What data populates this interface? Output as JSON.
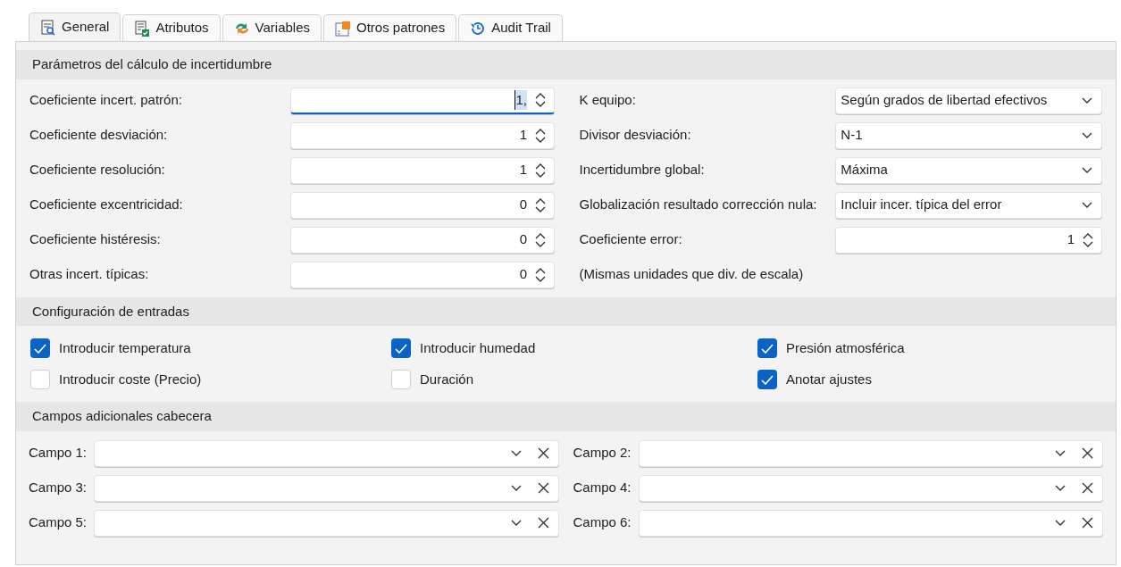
{
  "tabs": [
    {
      "label": "General",
      "kind": "report",
      "selected": true
    },
    {
      "label": "Atributos",
      "kind": "checklist",
      "selected": false
    },
    {
      "label": "Variables",
      "kind": "variables",
      "selected": false
    },
    {
      "label": "Otros patrones",
      "kind": "patterns",
      "selected": false
    },
    {
      "label": "Audit Trail",
      "kind": "history",
      "selected": false
    }
  ],
  "uncertainty": {
    "title": "Parámetros del cálculo de incertidumbre",
    "left": [
      {
        "label": "Coeficiente incert. patrón:",
        "value": "1,",
        "focused": true
      },
      {
        "label": "Coeficiente desviación:",
        "value": "1",
        "focused": false
      },
      {
        "label": "Coeficiente resolución:",
        "value": "1",
        "focused": false
      },
      {
        "label": "Coeficiente excentricidad:",
        "value": "0",
        "focused": false
      },
      {
        "label": "Coeficiente histéresis:",
        "value": "0",
        "focused": false
      },
      {
        "label": "Otras incert. típicas:",
        "value": "0",
        "focused": false
      }
    ],
    "right": [
      {
        "kind": "select",
        "label": "K equipo:",
        "value": "Según grados de libertad efectivos"
      },
      {
        "kind": "select",
        "label": "Divisor desviación:",
        "value": "N-1"
      },
      {
        "kind": "select",
        "label": "Incertidumbre global:",
        "value": "Máxima"
      },
      {
        "kind": "select",
        "label": "Globalización resultado corrección nula:",
        "value": "Incluir incer. típica del error"
      },
      {
        "kind": "spin",
        "label": "Coeficiente error:",
        "value": "1"
      },
      {
        "kind": "note",
        "label": "(Mismas unidades que div. de escala)"
      }
    ]
  },
  "inputs": {
    "title": "Configuración de entradas",
    "options": [
      {
        "label": "Introducir temperatura",
        "checked": true
      },
      {
        "label": "Introducir humedad",
        "checked": true
      },
      {
        "label": "Presión atmosférica",
        "checked": true
      },
      {
        "label": "Introducir coste (Precio)",
        "checked": false
      },
      {
        "label": "Duración",
        "checked": false
      },
      {
        "label": "Anotar ajustes",
        "checked": true
      }
    ]
  },
  "header_fields": {
    "title": "Campos adicionales cabecera",
    "fields": [
      {
        "label": "Campo 1:"
      },
      {
        "label": "Campo 2:"
      },
      {
        "label": "Campo 3:"
      },
      {
        "label": "Campo 4:"
      },
      {
        "label": "Campo 5:"
      },
      {
        "label": "Campo 6:"
      }
    ]
  }
}
